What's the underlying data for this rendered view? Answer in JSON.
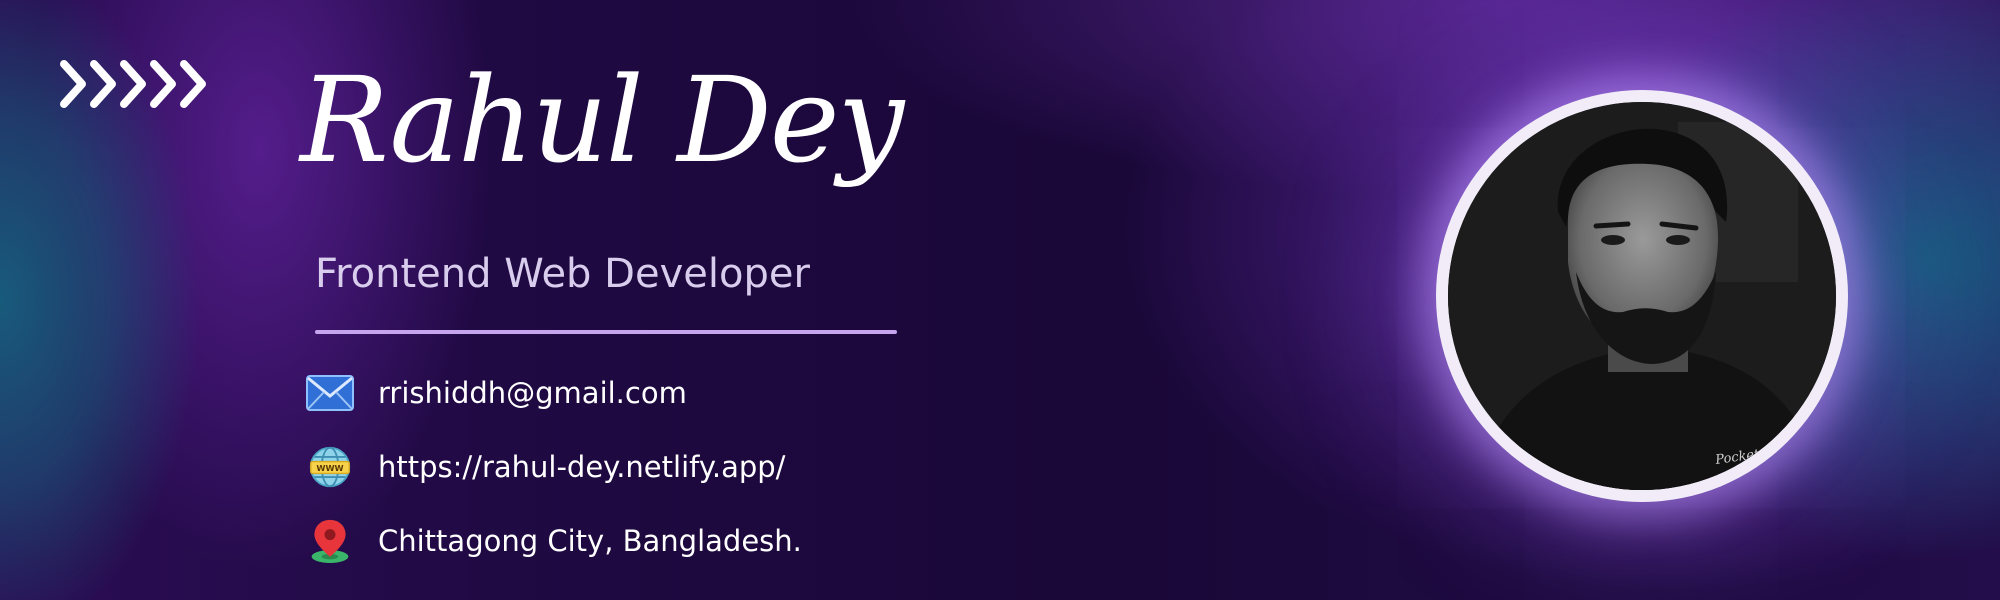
{
  "profile": {
    "name": "Rahul Dey",
    "title": "Frontend Web Developer"
  },
  "contact": {
    "email": "rrishiddh@gmail.com",
    "website": "https://rahul-dey.netlify.app/",
    "location": "Chittagong City, Bangladesh."
  },
  "icons": {
    "chevrons": "double-chevron-right-icon",
    "email": "envelope-icon",
    "website": "www-globe-icon",
    "location": "map-pin-icon"
  },
  "photo": {
    "shirt_text": "Pocket Collins"
  },
  "colors": {
    "background": "#1d0a3a",
    "accent_purple": "#6a2fb8",
    "accent_teal": "#175f7d",
    "divider": "#c6a4ee",
    "title_text": "#d9cdee",
    "frame": "#f1ecf8"
  }
}
